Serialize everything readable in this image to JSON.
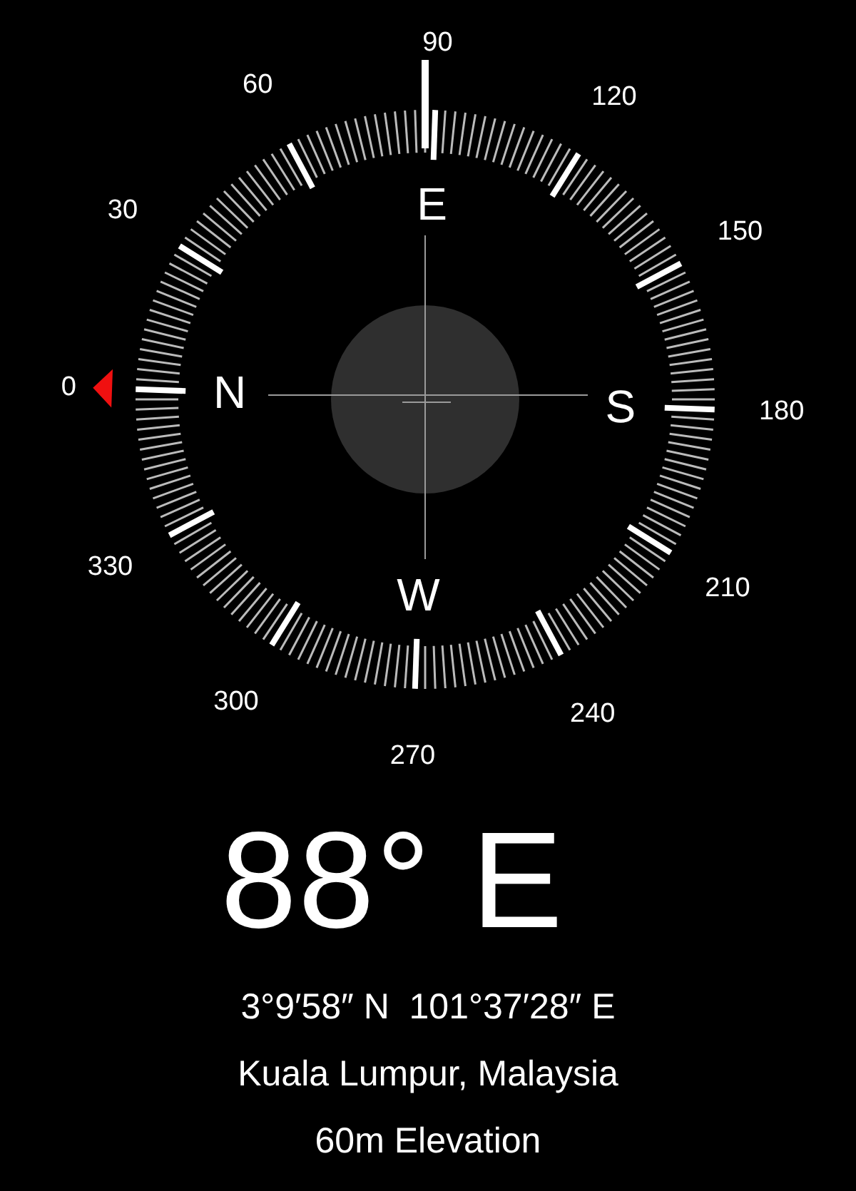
{
  "dial": {
    "degree_labels": [
      "0",
      "30",
      "60",
      "90",
      "120",
      "150",
      "180",
      "210",
      "240",
      "270",
      "300",
      "330"
    ],
    "cardinals": [
      "N",
      "E",
      "S",
      "W"
    ]
  },
  "heading": "88° E",
  "coordinates": "3°9′58″ N  101°37′28″ E",
  "place": "Kuala Lumpur, Malaysia",
  "elevation": "60m Elevation"
}
